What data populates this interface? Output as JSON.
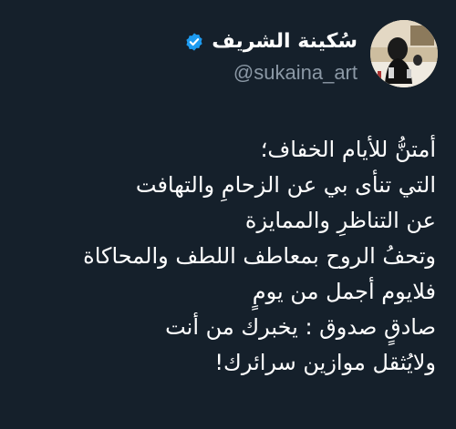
{
  "user": {
    "display_name": "سُكينة الشريف",
    "handle": "@sukaina_art",
    "verified": true,
    "avatar_icon": "profile-photo"
  },
  "tweet": {
    "lines": [
      "أمتنُّ للأيام الخفاف؛",
      "التي تنأى بي عن الزحامِ والتهافت",
      "عن التناظرِ والممايزة",
      "وتحفُ الروح بمعاطف اللطف والمحاكاة",
      "فلايوم أجمل من يومٍ",
      "صادقٍ صدوق : يخبرك من أنت",
      "ولايُثقل موازين سرائرك!"
    ]
  },
  "colors": {
    "background": "#15202b",
    "text": "#ffffff",
    "secondary_text": "#8b98a5",
    "verified_badge": "#1d9bf0"
  }
}
